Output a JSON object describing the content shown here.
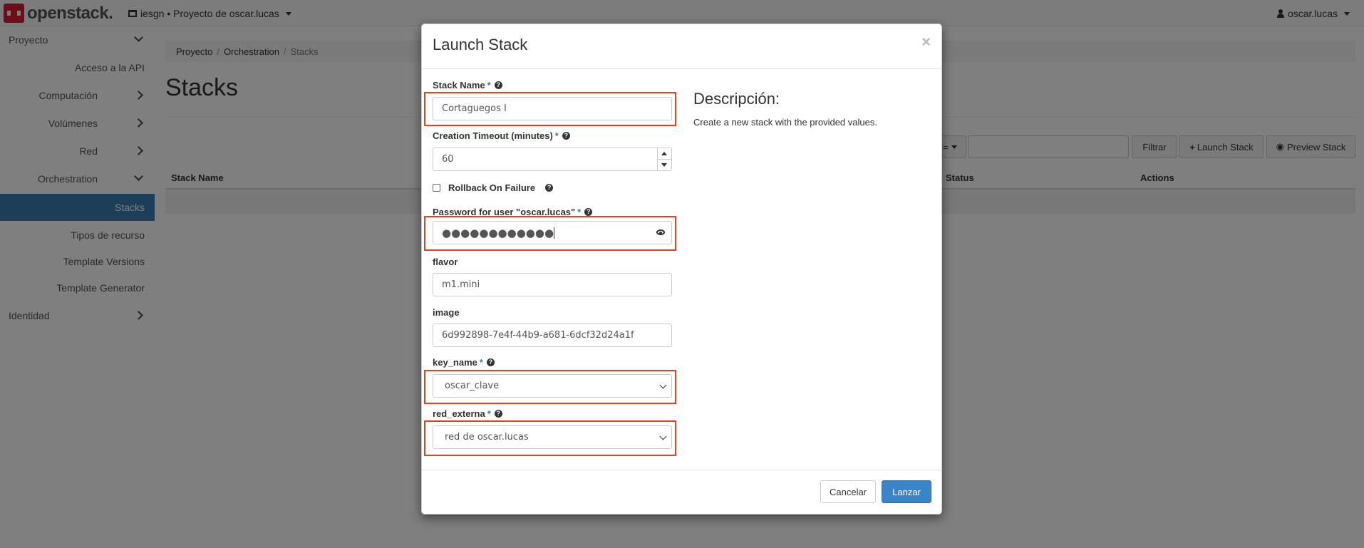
{
  "navbar": {
    "logo_text": "openstack.",
    "project_picker": "iesgn • Proyecto de oscar.lucas",
    "user": "oscar.lucas"
  },
  "sidebar": {
    "items": [
      {
        "label": "Proyecto"
      },
      {
        "label": "Acceso a la API"
      },
      {
        "label": "Computación"
      },
      {
        "label": "Volúmenes"
      },
      {
        "label": "Red"
      },
      {
        "label": "Orchestration"
      },
      {
        "label": "Stacks"
      },
      {
        "label": "Tipos de recurso"
      },
      {
        "label": "Template Versions"
      },
      {
        "label": "Template Generator"
      },
      {
        "label": "Identidad"
      }
    ]
  },
  "breadcrumb": {
    "items": [
      "Proyecto",
      "Orchestration",
      "Stacks"
    ]
  },
  "page": {
    "title": "Stacks"
  },
  "toolbar": {
    "filter_dropdown_label": "=",
    "filter_button": "Filtrar",
    "launch_button": "Launch Stack",
    "preview_button": "Preview Stack"
  },
  "table": {
    "columns": [
      "Stack Name",
      "Status",
      "Actions"
    ]
  },
  "modal": {
    "title": "Launch Stack",
    "close": "×",
    "fields": {
      "stack_name": {
        "label": "Stack Name",
        "value": "Cortaguegos I"
      },
      "timeout": {
        "label": "Creation Timeout (minutes)",
        "value": "60"
      },
      "rollback": {
        "label": "Rollback On Failure"
      },
      "password": {
        "label": "Password for user \"oscar.lucas\"",
        "value": "●●●●●●●●●●●●"
      },
      "flavor": {
        "label": "flavor",
        "value": "m1.mini"
      },
      "image": {
        "label": "image",
        "value": "6d992898-7e4f-44b9-a681-6dcf32d24a1f"
      },
      "key_name": {
        "label": "key_name",
        "value": "oscar_clave"
      },
      "red_externa": {
        "label": "red_externa",
        "value": "red de oscar.lucas"
      }
    },
    "description_title": "Descripción:",
    "description_text": "Create a new stack with the provided values.",
    "cancel_button": "Cancelar",
    "launch_button": "Lanzar",
    "required_mark": "*",
    "help_mark": "?"
  },
  "colors": {
    "accent": "#3a7db3",
    "highlight": "#e8401c",
    "brand": "#da1a32"
  }
}
